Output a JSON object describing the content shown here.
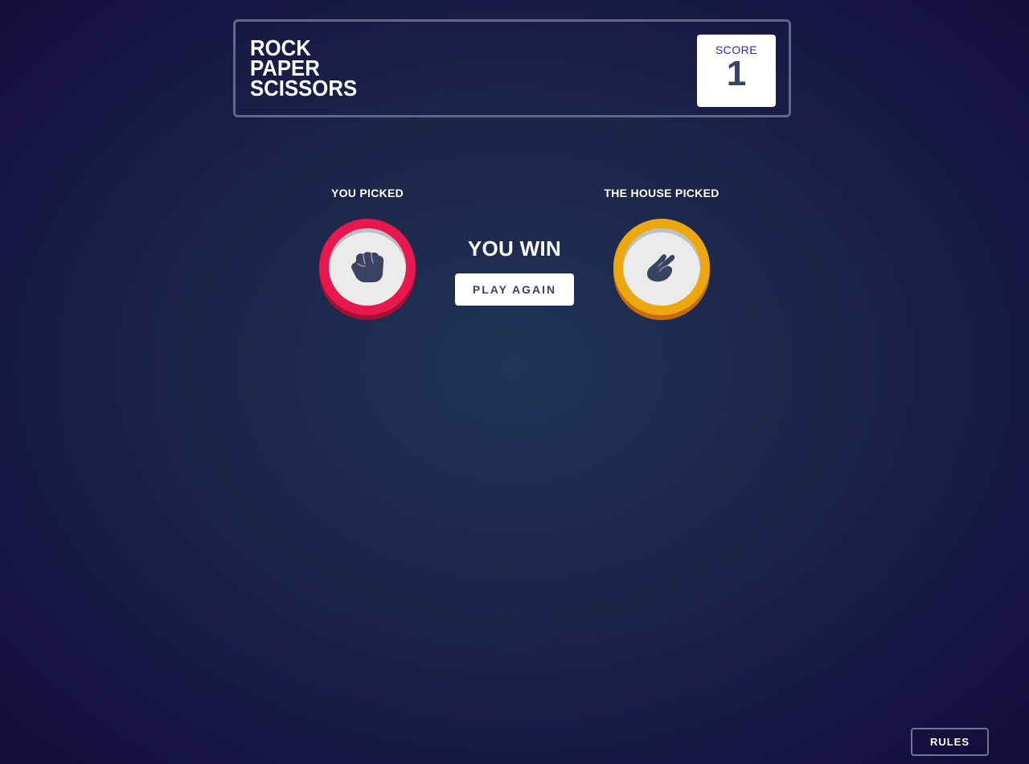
{
  "header": {
    "title_lines": [
      "ROCK",
      "PAPER",
      "SCISSORS"
    ],
    "score_label": "SCORE",
    "score_value": "1"
  },
  "game": {
    "player_label": "YOU PICKED",
    "house_label": "THE HOUSE PICKED",
    "player_choice": "rock",
    "house_choice": "scissors",
    "result": "YOU WIN",
    "play_again_label": "PLAY AGAIN"
  },
  "footer": {
    "rules_label": "RULES"
  },
  "colors": {
    "rock": "#e8174d",
    "scissors": "#eca70f",
    "score_label": "#3b1ec0",
    "dark_text": "#3b4363"
  },
  "icons": {
    "player": "rock-fist-icon",
    "house": "scissors-hand-icon"
  }
}
